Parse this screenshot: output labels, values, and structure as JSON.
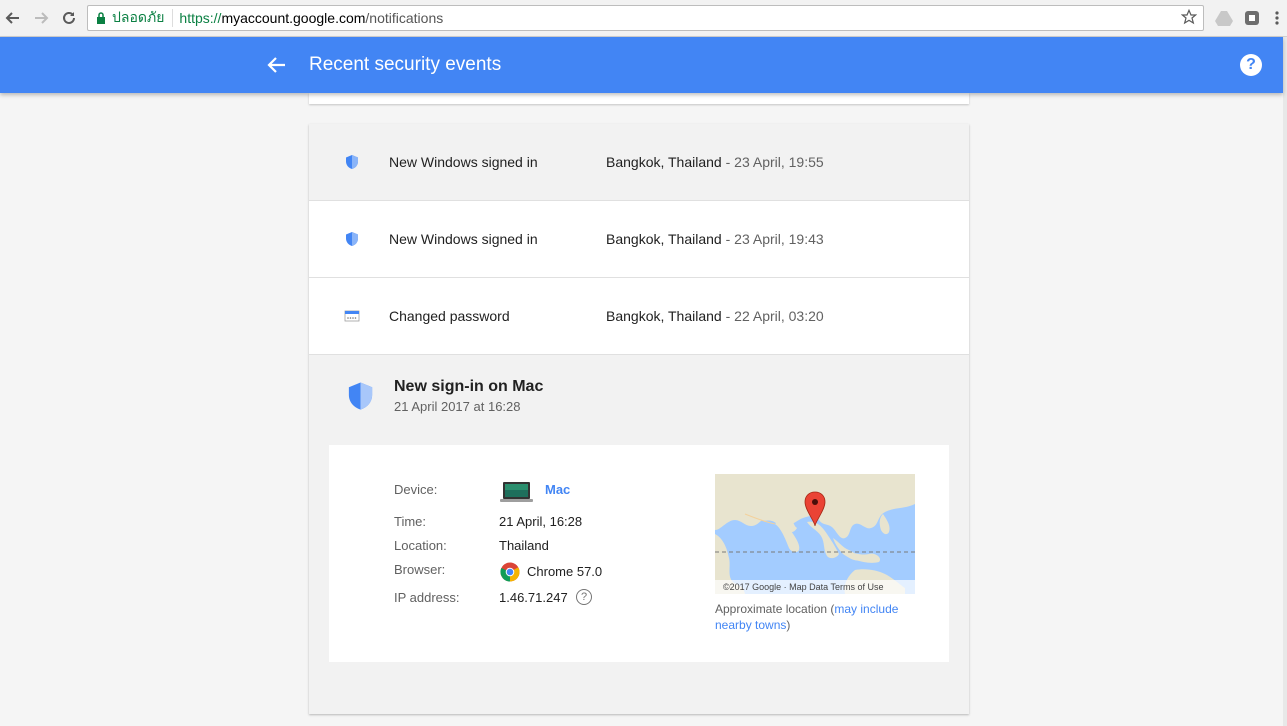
{
  "browser": {
    "secure_label": "ปลอดภัย",
    "url_scheme": "https://",
    "url_host": "myaccount.google.com",
    "url_path": "/notifications"
  },
  "header": {
    "title": "Recent security events",
    "help_symbol": "?",
    "color": "#4285f4"
  },
  "events": [
    {
      "title": "New Windows signed in",
      "location": "Bangkok, Thailand",
      "when": " - 23 April, 19:55",
      "icon": "shield-icon"
    },
    {
      "title": "New Windows signed in",
      "location": "Bangkok, Thailand",
      "when": " - 23 April, 19:43",
      "icon": "shield-icon"
    },
    {
      "title": "Changed password",
      "location": "Bangkok, Thailand",
      "when": " - 22 April, 03:20",
      "icon": "password-icon"
    }
  ],
  "expanded_event": {
    "title": "New sign-in on Mac",
    "date": "21 April 2017 at 16:28",
    "details": {
      "device_label": "Device:",
      "device_value": "Mac",
      "time_label": "Time:",
      "time_value": "21 April, 16:28",
      "location_label": "Location:",
      "location_value": "Thailand",
      "browser_label": "Browser:",
      "browser_value": "Chrome 57.0",
      "ip_label": "IP address:",
      "ip_value": "1.46.71.247",
      "ip_help": "?"
    },
    "map_attribution": "©2017 Google · Map Data   Terms of Use",
    "approx_prefix": "Approximate location (",
    "approx_link": "may include nearby towns",
    "approx_suffix": ")"
  }
}
